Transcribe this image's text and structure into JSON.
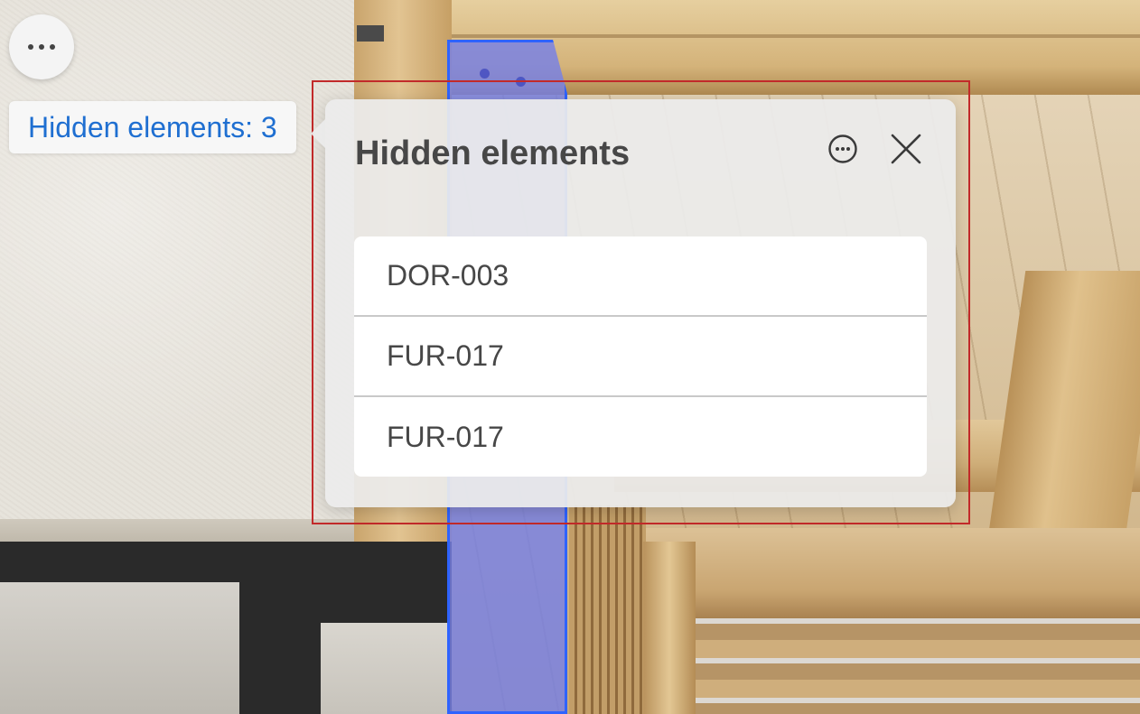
{
  "toolbar": {
    "more_button_icon": "more-horizontal-icon"
  },
  "hidden_chip": {
    "label": "Hidden elements: 3",
    "color": "#1f6fd1"
  },
  "panel": {
    "title": "Hidden elements",
    "menu_icon": "more-circle-icon",
    "close_icon": "close-icon",
    "items": [
      {
        "label": "DOR-003"
      },
      {
        "label": "FUR-017"
      },
      {
        "label": "FUR-017"
      }
    ]
  },
  "colors": {
    "selection_fill": "#7680e6",
    "selection_border": "#2f63ff",
    "focus_outline": "#c22a2a",
    "text_dark": "#474747"
  }
}
